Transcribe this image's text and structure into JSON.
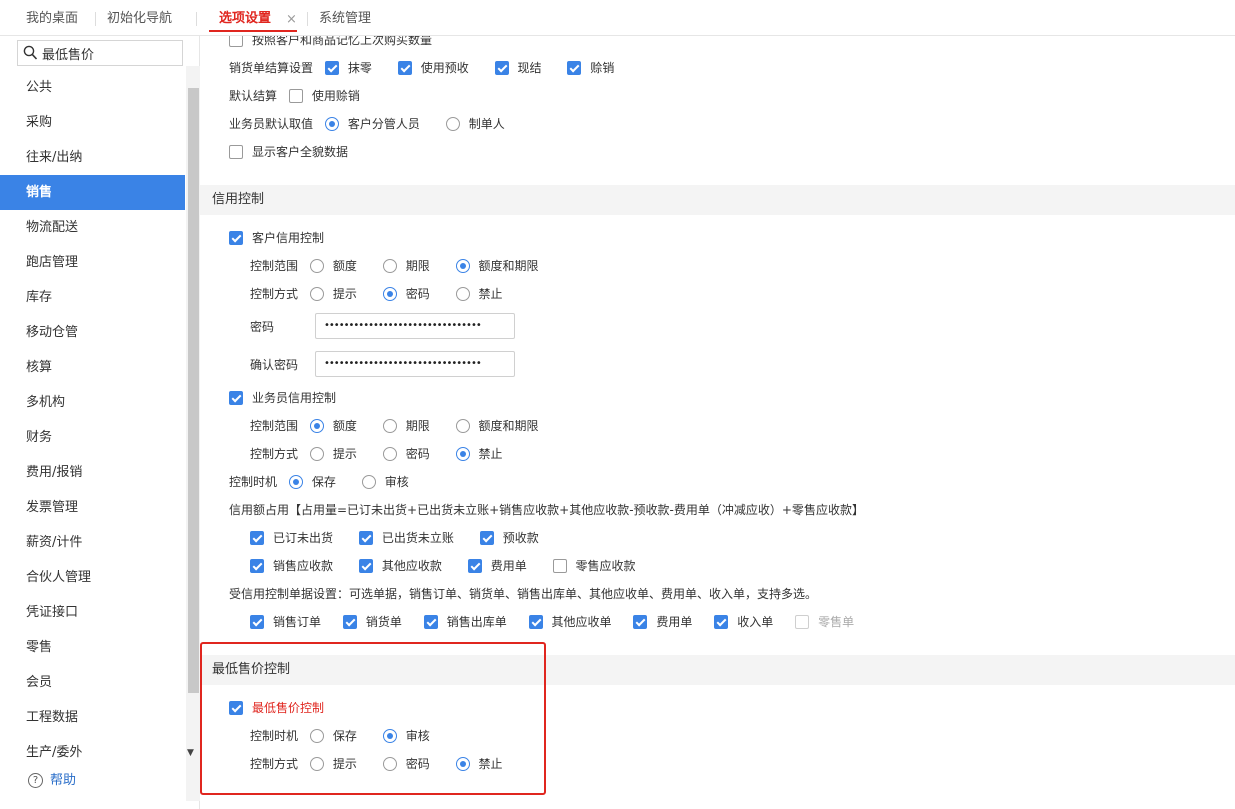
{
  "tabs": [
    {
      "label": "我的桌面"
    },
    {
      "label": "初始化导航"
    },
    {
      "label": "选项设置",
      "close": "×"
    },
    {
      "label": "系统管理"
    }
  ],
  "sidebar": {
    "search_value": "最低售价",
    "items": [
      "公共",
      "采购",
      "往来/出纳",
      "销售",
      "物流配送",
      "跑店管理",
      "库存",
      "移动仓管",
      "核算",
      "多机构",
      "财务",
      "费用/报销",
      "发票管理",
      "薪资/计件",
      "合伙人管理",
      "凭证接口",
      "零售",
      "会员",
      "工程数据",
      "生产/委外"
    ],
    "active_item": "销售",
    "help_label": "帮助"
  },
  "top_section": {
    "remember_label": "按照客户和商品记忆上次购买数量",
    "settle_label": "销货单结算设置",
    "settle_options": [
      "抹零",
      "使用预收",
      "现结",
      "赊销"
    ],
    "default_settle_label": "默认结算",
    "use_credit_sale": "使用赊销",
    "salesman_label": "业务员默认取值",
    "salesman_options": [
      "客户分管人员",
      "制单人"
    ],
    "show_customer_all": "显示客户全貌数据"
  },
  "credit": {
    "section_title": "信用控制",
    "customer_credit": "客户信用控制",
    "scope_label": "控制范围",
    "scope_options": [
      "额度",
      "期限",
      "额度和期限"
    ],
    "method_label": "控制方式",
    "method_options": [
      "提示",
      "密码",
      "禁止"
    ],
    "password_label": "密码",
    "password_value": "••••••••••••••••••••••••••••••••",
    "confirm_password_label": "确认密码",
    "confirm_password_value": "••••••••••••••••••••••••••••••••",
    "salesman_credit": "业务员信用控制",
    "timing_label": "控制时机",
    "timing_options": [
      "保存",
      "审核"
    ],
    "occupy_text": "信用额占用【占用量=已订未出货+已出货未立账+销售应收款+其他应收款-预收款-费用单（冲减应收）+零售应收款】",
    "occupy_row1": [
      "已订未出货",
      "已出货未立账",
      "预收款"
    ],
    "occupy_row2": [
      "销售应收款",
      "其他应收款",
      "费用单",
      "零售应收款"
    ],
    "docs_text": "受信用控制单据设置：可选单据，销售订单、销货单、销售出库单、其他应收单、费用单、收入单，支持多选。",
    "docs_options": [
      "销售订单",
      "销货单",
      "销售出库单",
      "其他应收单",
      "费用单",
      "收入单",
      "零售单"
    ]
  },
  "min_price": {
    "section_title": "最低售价控制",
    "enable_label": "最低售价控制",
    "timing_label": "控制时机",
    "timing_options": [
      "保存",
      "审核"
    ],
    "method_label": "控制方式",
    "method_options": [
      "提示",
      "密码",
      "禁止"
    ]
  },
  "colors": {
    "accent": "#3a83e6",
    "highlight": "#e0261f"
  }
}
